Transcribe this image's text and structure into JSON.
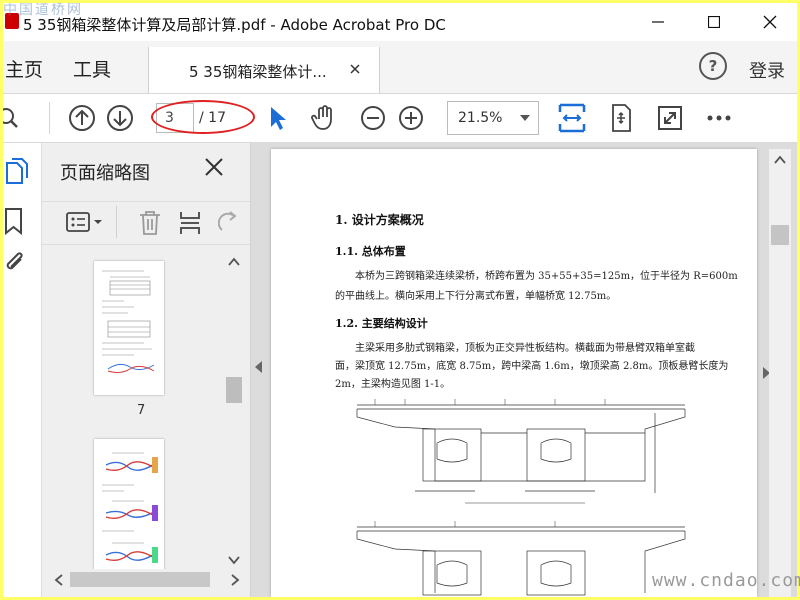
{
  "window": {
    "title": "5 35钢箱梁整体计算及局部计算.pdf - Adobe Acrobat Pro DC",
    "watermark_top": "中国道桥网"
  },
  "tabs": {
    "home": "主页",
    "tools": "工具",
    "document": "5 35钢箱梁整体计...",
    "login": "登录",
    "help": "?"
  },
  "toolbar": {
    "page_current": "3",
    "page_total": "/ 17",
    "zoom": "21.5%"
  },
  "panel": {
    "title": "页面缩略图",
    "thumb_labels": [
      "7"
    ]
  },
  "document": {
    "h1": "1. 设计方案概况",
    "h1_1": "1.1. 总体布置",
    "p1_line1": "本桥为三跨钢箱梁连续梁桥，桥跨布置为 35+55+35=125m，位于半径为 R=600m",
    "p1_line2": "的平曲线上。横向采用上下行分离式布置，单幅桥宽 12.75m。",
    "h1_2": "1.2. 主要结构设计",
    "p2_line1": "主梁采用多肋式钢箱梁，顶板为正交异性板结构。横截面为带悬臂双箱单室截",
    "p2_line2": "面，梁顶宽 12.75m，底宽 8.75m，跨中梁高 1.6m，墩顶梁高 2.8m。顶板悬臂长度为",
    "p2_line3": "2m，主梁构造见图 1-1。"
  },
  "watermark_br": "www.cndao.com",
  "colors": {
    "accent": "#1b6ed8",
    "highlight_ellipse": "#e02020",
    "frame": "#ffff66"
  }
}
